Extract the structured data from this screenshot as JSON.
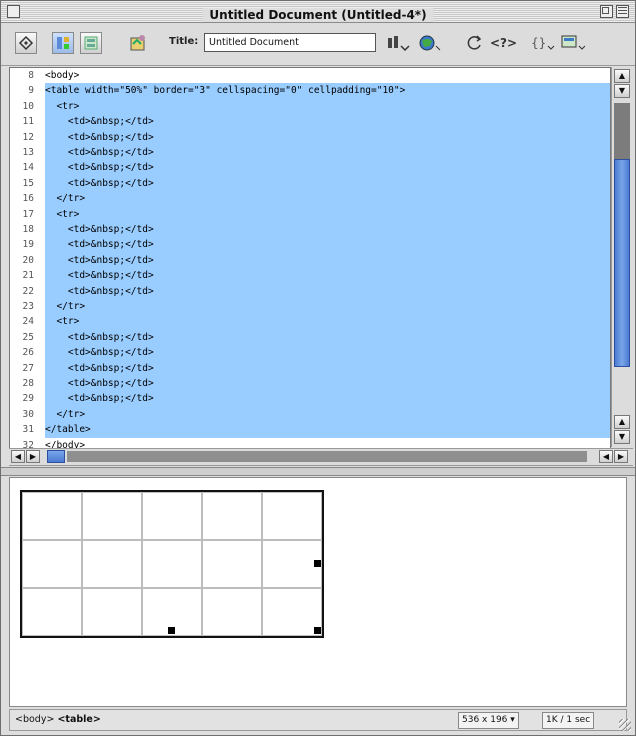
{
  "window": {
    "title": "Untitled Document (Untitled-4*)"
  },
  "toolbar": {
    "title_label": "Title:",
    "title_value": "Untitled Document",
    "icons": [
      "code-view-icon",
      "split-view-icon",
      "design-view-icon",
      "live-data-icon",
      "file-management-icon",
      "browser-preview-icon",
      "refresh-icon",
      "reference-icon",
      "code-navigation-icon",
      "view-options-icon"
    ]
  },
  "code": {
    "lines": [
      {
        "n": "8",
        "text": "<body>",
        "sel": false
      },
      {
        "n": "9",
        "text": "<table width=\"50%\" border=\"3\" cellspacing=\"0\" cellpadding=\"10\">",
        "sel": true
      },
      {
        "n": "10",
        "text": "  <tr>",
        "sel": true
      },
      {
        "n": "11",
        "text": "    <td>&nbsp;</td>",
        "sel": true
      },
      {
        "n": "12",
        "text": "    <td>&nbsp;</td>",
        "sel": true
      },
      {
        "n": "13",
        "text": "    <td>&nbsp;</td>",
        "sel": true
      },
      {
        "n": "14",
        "text": "    <td>&nbsp;</td>",
        "sel": true
      },
      {
        "n": "15",
        "text": "    <td>&nbsp;</td>",
        "sel": true
      },
      {
        "n": "16",
        "text": "  </tr>",
        "sel": true
      },
      {
        "n": "17",
        "text": "  <tr>",
        "sel": true
      },
      {
        "n": "18",
        "text": "    <td>&nbsp;</td>",
        "sel": true
      },
      {
        "n": "19",
        "text": "    <td>&nbsp;</td>",
        "sel": true
      },
      {
        "n": "20",
        "text": "    <td>&nbsp;</td>",
        "sel": true
      },
      {
        "n": "21",
        "text": "    <td>&nbsp;</td>",
        "sel": true
      },
      {
        "n": "22",
        "text": "    <td>&nbsp;</td>",
        "sel": true
      },
      {
        "n": "23",
        "text": "  </tr>",
        "sel": true
      },
      {
        "n": "24",
        "text": "  <tr>",
        "sel": true
      },
      {
        "n": "25",
        "text": "    <td>&nbsp;</td>",
        "sel": true
      },
      {
        "n": "26",
        "text": "    <td>&nbsp;</td>",
        "sel": true
      },
      {
        "n": "27",
        "text": "    <td>&nbsp;</td>",
        "sel": true
      },
      {
        "n": "28",
        "text": "    <td>&nbsp;</td>",
        "sel": true
      },
      {
        "n": "29",
        "text": "    <td>&nbsp;</td>",
        "sel": true
      },
      {
        "n": "30",
        "text": "  </tr>",
        "sel": true
      },
      {
        "n": "31",
        "text": "</table>",
        "sel": true
      },
      {
        "n": "32",
        "text": "</body>",
        "sel": false
      }
    ]
  },
  "design": {
    "rows": 3,
    "cols": 5
  },
  "status": {
    "tag_body": "<body>",
    "tag_table": "<table>",
    "dimensions": "536 x 196",
    "download": "1K / 1 sec"
  },
  "colors": {
    "selection": "#99ccff",
    "code_tag": "#1a3fa8",
    "scroll_thumb": "#4a7bd1"
  }
}
